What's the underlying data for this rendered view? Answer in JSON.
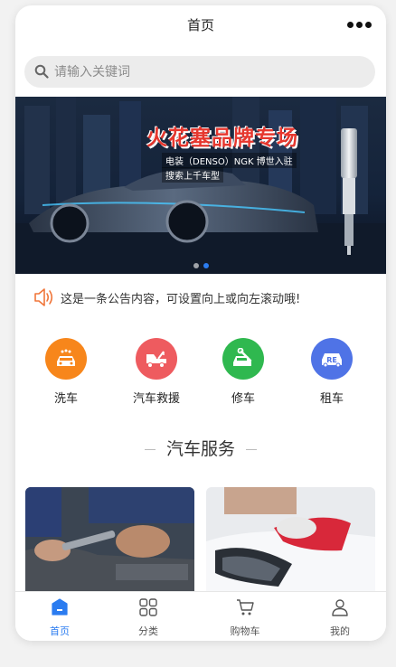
{
  "header": {
    "title": "首页"
  },
  "search": {
    "placeholder": "请输入关键词"
  },
  "banner": {
    "title": "火花塞品牌专场",
    "subtitle": "电装（DENSO）NGK 博世入驻",
    "subtitle2": "搜索上千车型",
    "slide_count": 2,
    "active_slide": 2
  },
  "notice": {
    "text": "这是一条公告内容，可设置向上或向左滚动哦!"
  },
  "services": [
    {
      "label": "洗车",
      "icon": "car-wash-icon",
      "color": "#f7861b"
    },
    {
      "label": "汽车救援",
      "icon": "tow-truck-icon",
      "color": "#ee5b5f"
    },
    {
      "label": "修车",
      "icon": "car-repair-icon",
      "color": "#2fb84f"
    },
    {
      "label": "租车",
      "icon": "car-rental-icon",
      "color": "#4f73e6"
    }
  ],
  "section": {
    "title": "汽车服务"
  },
  "tabbar": [
    {
      "label": "首页",
      "icon": "home-icon",
      "active": true
    },
    {
      "label": "分类",
      "icon": "category-grid-icon",
      "active": false
    },
    {
      "label": "购物车",
      "icon": "cart-icon",
      "active": false
    },
    {
      "label": "我的",
      "icon": "user-icon",
      "active": false
    }
  ],
  "colors": {
    "accent": "#2b7cf0",
    "notice_icon": "#f0763a"
  }
}
